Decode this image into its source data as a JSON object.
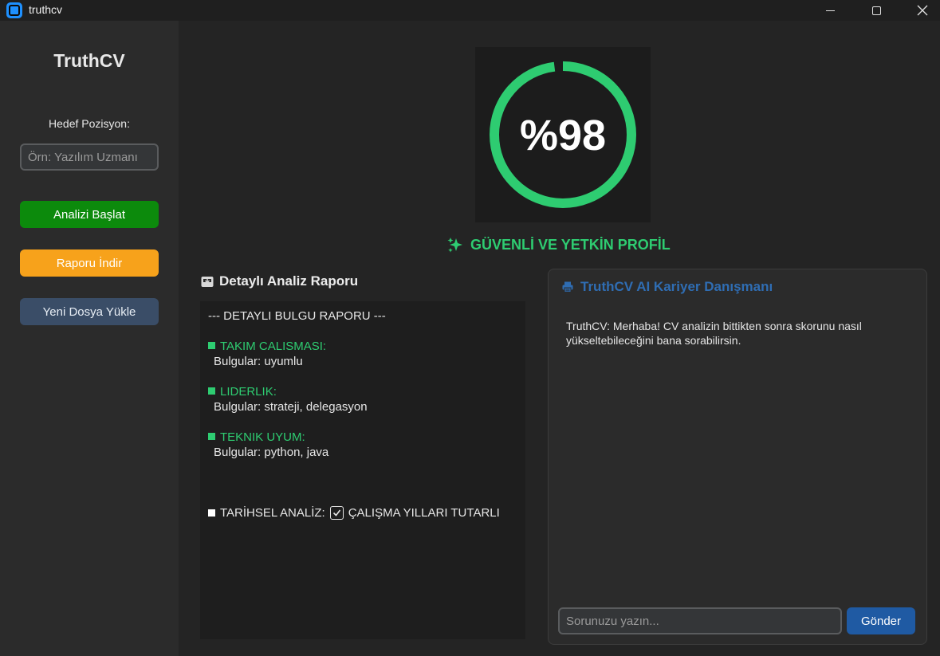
{
  "window": {
    "title": "truthcv",
    "icon": "app-icon"
  },
  "sidebar": {
    "brand": "TruthCV",
    "target_label": "Hedef Pozisyon:",
    "target_placeholder": "Örn: Yazılım Uzmanı",
    "buttons": {
      "start": "Analizi Başlat",
      "report": "Raporu İndir",
      "upload": "Yeni Dosya Yükle"
    }
  },
  "score": {
    "text": "%98",
    "value_percent": 98,
    "color": "#2ecc71",
    "verdict": "GÜVENLİ VE YETKİN PROFİL",
    "verdict_icon": "sparkles-icon"
  },
  "report": {
    "heading": "Detaylı Analiz Raporu",
    "heading_icon": "inbox-tray-icon",
    "title_line": "--- DETAYLI BULGU RAPORU ---",
    "sections": [
      {
        "title": "TAKIM CALISMASI:",
        "findings": "Bulgular: uyumlu"
      },
      {
        "title": "LIDERLIK:",
        "findings": "Bulgular: strateji, delegasyon"
      },
      {
        "title": "TEKNIK UYUM:",
        "findings": "Bulgular: python, java"
      }
    ],
    "history_label": "TARİHSEL ANALİZ:",
    "history_value": "ÇALIŞMA YILLARI TUTARLI"
  },
  "chat": {
    "title": "TruthCV AI Kariyer Danışmanı",
    "title_icon": "printer-icon",
    "message": "TruthCV: Merhaba! CV analizin bittikten sonra skorunu nasıl yükseltebileceğini bana sorabilirsin.",
    "input_placeholder": "Sorunuzu yazın...",
    "send_label": "Gönder"
  },
  "colors": {
    "accent_green": "#2ecc71",
    "start_button": "#0c8a0c",
    "report_button": "#f7a21b",
    "upload_button": "#3a4d67",
    "send_button": "#1f5aa3",
    "chat_title": "#2f6db3"
  }
}
